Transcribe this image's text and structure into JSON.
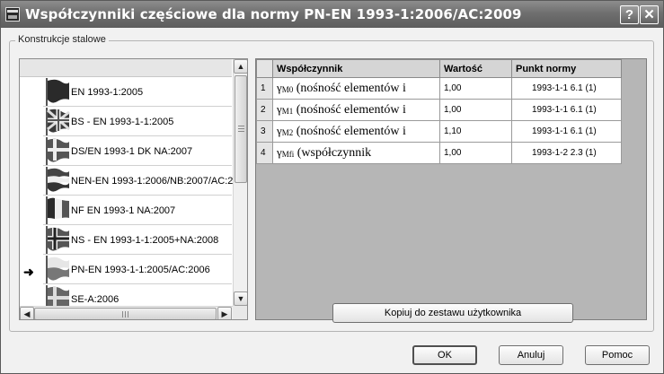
{
  "window": {
    "title": "Współczynniki częściowe dla normy PN-EN 1993-1:2006/AC:2009",
    "help_label": "?",
    "close_label": "✕"
  },
  "group": {
    "label": "Konstrukcje stalowe"
  },
  "list": {
    "selected_index": 6,
    "items": [
      {
        "label": "EN 1993-1:2005",
        "flag": "eu-flag-icon"
      },
      {
        "label": "BS - EN 1993-1-1:2005",
        "flag": "uk-flag-icon"
      },
      {
        "label": "DS/EN 1993-1 DK NA:2007",
        "flag": "denmark-flag-icon"
      },
      {
        "label": "NEN-EN 1993-1:2006/NB:2007/AC:2",
        "flag": "netherlands-flag-icon"
      },
      {
        "label": "NF EN 1993-1 NA:2007",
        "flag": "france-flag-icon"
      },
      {
        "label": "NS - EN 1993-1-1:2005+NA:2008",
        "flag": "norway-flag-icon"
      },
      {
        "label": "PN-EN 1993-1-1:2005/AC:2006",
        "flag": "poland-flag-icon"
      },
      {
        "label": "SE-A:2006",
        "flag": "sweden-flag-icon"
      }
    ],
    "selection_marker": "➜"
  },
  "grid": {
    "columns": [
      "Współczynnik",
      "Wartość",
      "Punkt normy"
    ],
    "rows": [
      {
        "num": "1",
        "symbol": "γ",
        "sub": "M0",
        "desc": " (nośność elementów i",
        "value": "1,00",
        "ref": "1993-1-1  6.1 (1)"
      },
      {
        "num": "2",
        "symbol": "γ",
        "sub": "M1",
        "desc": " (nośność elementów i",
        "value": "1,00",
        "ref": "1993-1-1  6.1 (1)"
      },
      {
        "num": "3",
        "symbol": "γ",
        "sub": "M2",
        "desc": " (nośność elementów i",
        "value": "1,10",
        "ref": "1993-1-1  6.1 (1)"
      },
      {
        "num": "4",
        "symbol": "γ",
        "sub": "Mfi",
        "desc": " (współczynnik",
        "value": "1,00",
        "ref": "1993-1-2  2.3 (1)"
      }
    ]
  },
  "actions": {
    "copy_label": "Kopiuj do zestawu użytkownika",
    "ok_label": "OK",
    "cancel_label": "Anuluj",
    "help_label": "Pomoc"
  }
}
